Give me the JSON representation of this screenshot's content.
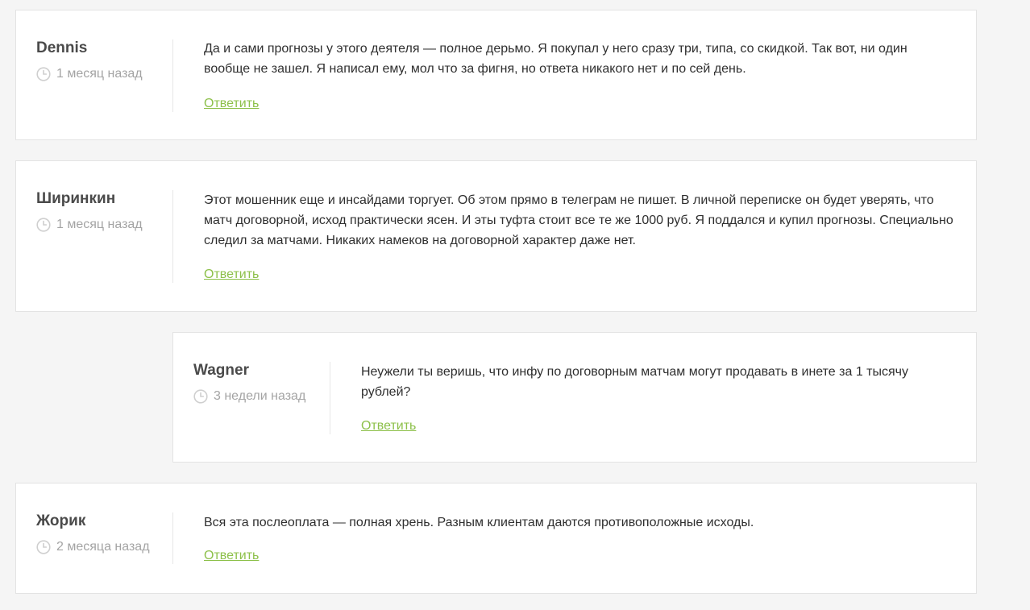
{
  "icons": {
    "date": "clock-icon"
  },
  "colors": {
    "reply_link": "#8dc04a",
    "page_bg": "#f5f5f5",
    "card_bg": "#ffffff"
  },
  "comments": [
    {
      "author": "Dennis",
      "date": "1 месяц назад",
      "text": "Да и сами прогнозы у этого деятеля — полное дерьмо. Я покупал у него сразу три, типа, со скидкой. Так вот, ни один вообще не зашел. Я написал ему, мол что за фигня, но ответа никакого нет и по сей день.",
      "reply": "Ответить"
    },
    {
      "author": "Ширинкин",
      "date": "1 месяц назад",
      "text": "Этот мошенник еще и инсайдами торгует. Об этом прямо в телеграм не пишет. В личной переписке он будет уверять, что матч договорной, исход практически ясен. И эты туфта стоит все те же 1000 руб. Я поддался и купил прогнозы. Специально следил за матчами. Никаких намеков на договорной характер даже нет.",
      "reply": "Ответить"
    },
    {
      "author": "Wagner",
      "date": "3 недели назад",
      "text": "Неужели ты веришь, что инфу по договорным матчам могут продавать в инете за 1 тысячу рублей?",
      "reply": "Ответить"
    },
    {
      "author": "Жорик",
      "date": "2 месяца назад",
      "text": "Вся эта послеоплата — полная хрень. Разным клиентам даются противоположные исходы.",
      "reply": "Ответить"
    }
  ]
}
